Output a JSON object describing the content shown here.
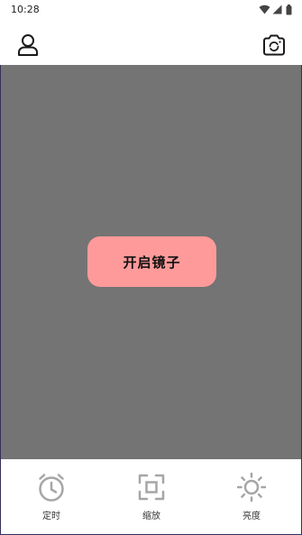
{
  "status_bar": {
    "time": "10:28"
  },
  "app_bar": {
    "profile_icon": "person-outline-icon",
    "camera_icon": "camera-switch-icon"
  },
  "mirror": {
    "open_button_label": "开启镜子"
  },
  "toolbar": {
    "items": [
      {
        "label": "定时",
        "icon": "alarm-clock-icon"
      },
      {
        "label": "缩放",
        "icon": "zoom-frame-icon"
      },
      {
        "label": "亮度",
        "icon": "sun-icon"
      }
    ]
  },
  "colors": {
    "mirror_background": "#747474",
    "button_background": "#ff9a9a",
    "icon_gray": "#a6a6a6"
  }
}
